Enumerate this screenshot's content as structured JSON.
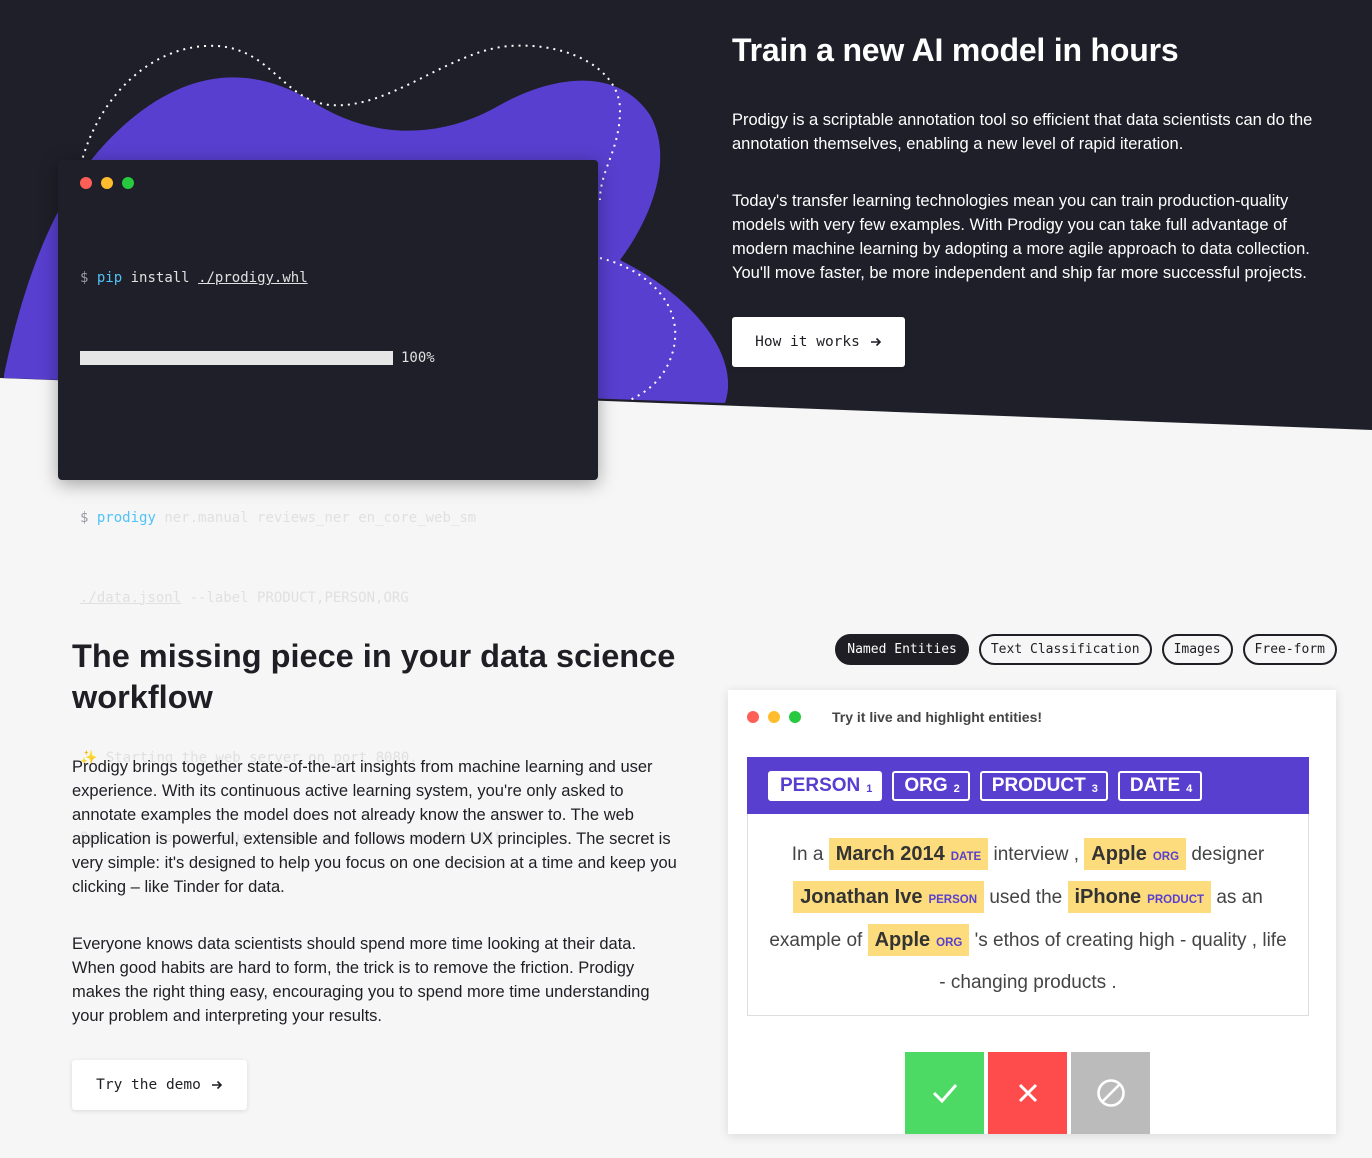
{
  "colors": {
    "dark_bg": "#1e1f28",
    "accent_purple": "#583fcf",
    "light_bg": "#f6f6f6",
    "entity_highlight": "#fddc7d",
    "accept_green": "#4cd964",
    "reject_red": "#fe4b4b",
    "ignore_gray": "#bbbbbb",
    "dot_red": "#ff5f56",
    "dot_yellow": "#ffbd2e",
    "dot_green": "#27c93f"
  },
  "terminal": {
    "prompt": "$",
    "cmd1": "pip",
    "cmd1_rest": "install",
    "cmd1_file": "./prodigy.whl",
    "progress_fraction": 1.0,
    "progress_label": "100%",
    "cmd2": "prodigy",
    "cmd2_rest": "ner.manual reviews_ner en_core_web_sm",
    "cmd2_file": "./data.jsonl",
    "cmd2_rest2": "--label PRODUCT,PERSON,ORG",
    "sparkle_icon": "✨",
    "out1": "Starting the web server on port 8080...",
    "out2": "Open the app in your browser and start annotating!"
  },
  "hero": {
    "title": "Train a new AI model in hours",
    "p1": "Prodigy is a scriptable annotation tool so efficient that data scientists can do the annotation themselves, enabling a new level of rapid iteration.",
    "p2": "Today's transfer learning technologies mean you can train production-quality models with very few examples. With Prodigy you can take full advantage of modern machine learning by adopting a more agile approach to data collection. You'll move faster, be more independent and ship far more successful projects.",
    "button": "How it works",
    "arrow_icon": "arrow-right-icon"
  },
  "section": {
    "title": "The missing piece in your data science workflow",
    "p1": "Prodigy brings together state-of-the-art insights from machine learning and user experience. With its continuous active learning system, you're only asked to annotate examples the model does not already know the answer to. The web application is powerful, extensible and follows modern UX principles. The secret is very simple: it's designed to help you focus on one decision at a time and keep you clicking – like Tinder for data.",
    "p2": "Everyone knows data scientists should spend more time looking at their data. When good habits are hard to form, the trick is to remove the friction. Prodigy makes the right thing easy, encouraging you to spend more time understanding your problem and interpreting your results.",
    "button": "Try the demo"
  },
  "tabs": [
    {
      "label": "Named Entities",
      "active": true
    },
    {
      "label": "Text Classification",
      "active": false
    },
    {
      "label": "Images",
      "active": false
    },
    {
      "label": "Free-form",
      "active": false
    }
  ],
  "demo": {
    "hint": "Try it live and highlight entities!",
    "labels": [
      {
        "name": "PERSON",
        "key": "1",
        "selected": true
      },
      {
        "name": "ORG",
        "key": "2",
        "selected": false
      },
      {
        "name": "PRODUCT",
        "key": "3",
        "selected": false
      },
      {
        "name": "DATE",
        "key": "4",
        "selected": false
      }
    ],
    "tokens": [
      {
        "text": "In a"
      },
      {
        "text": "March 2014",
        "label": "DATE"
      },
      {
        "text": "interview ,"
      },
      {
        "text": "Apple",
        "label": "ORG"
      },
      {
        "text": "designer"
      },
      {
        "text": "Jonathan Ive",
        "label": "PERSON"
      },
      {
        "text": "used the"
      },
      {
        "text": "iPhone",
        "label": "PRODUCT"
      },
      {
        "text": "as an example of"
      },
      {
        "text": "Apple",
        "label": "ORG"
      },
      {
        "text": "'s ethos of creating high - quality , life - changing products ."
      }
    ],
    "actions": [
      {
        "name": "accept",
        "icon": "check-icon"
      },
      {
        "name": "reject",
        "icon": "cross-icon"
      },
      {
        "name": "ignore",
        "icon": "ignore-icon"
      }
    ]
  }
}
